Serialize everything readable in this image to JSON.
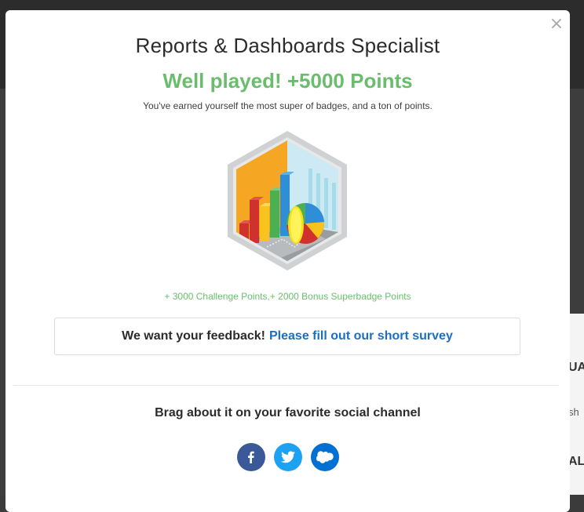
{
  "modal": {
    "title": "Reports & Dashboards Specialist",
    "subtitle": "Well played! +5000 Points",
    "description": "You've earned yourself the most super of badges, and a ton of points.",
    "points_line": "+ 3000 Challenge Points,+ 2000 Bonus Superbadge Points",
    "feedback_prefix": "We want your feedback!",
    "feedback_link": "Please fill out our short survey",
    "brag_text": "Brag about it on your favorite social channel",
    "close_symbol": "×"
  },
  "social": [
    {
      "name": "facebook",
      "icon": "facebook-icon",
      "color": "#3b5998"
    },
    {
      "name": "twitter",
      "icon": "twitter-icon",
      "color": "#1da1f2"
    },
    {
      "name": "salesforce",
      "icon": "salesforce-cloud-icon",
      "color": "#0070d2"
    }
  ],
  "background": {
    "right_text_1": "UA",
    "right_text_2": "sh",
    "right_text_3": "AL"
  },
  "colors": {
    "accent_green": "#6bbd6e",
    "link_blue": "#1b6fc2"
  }
}
